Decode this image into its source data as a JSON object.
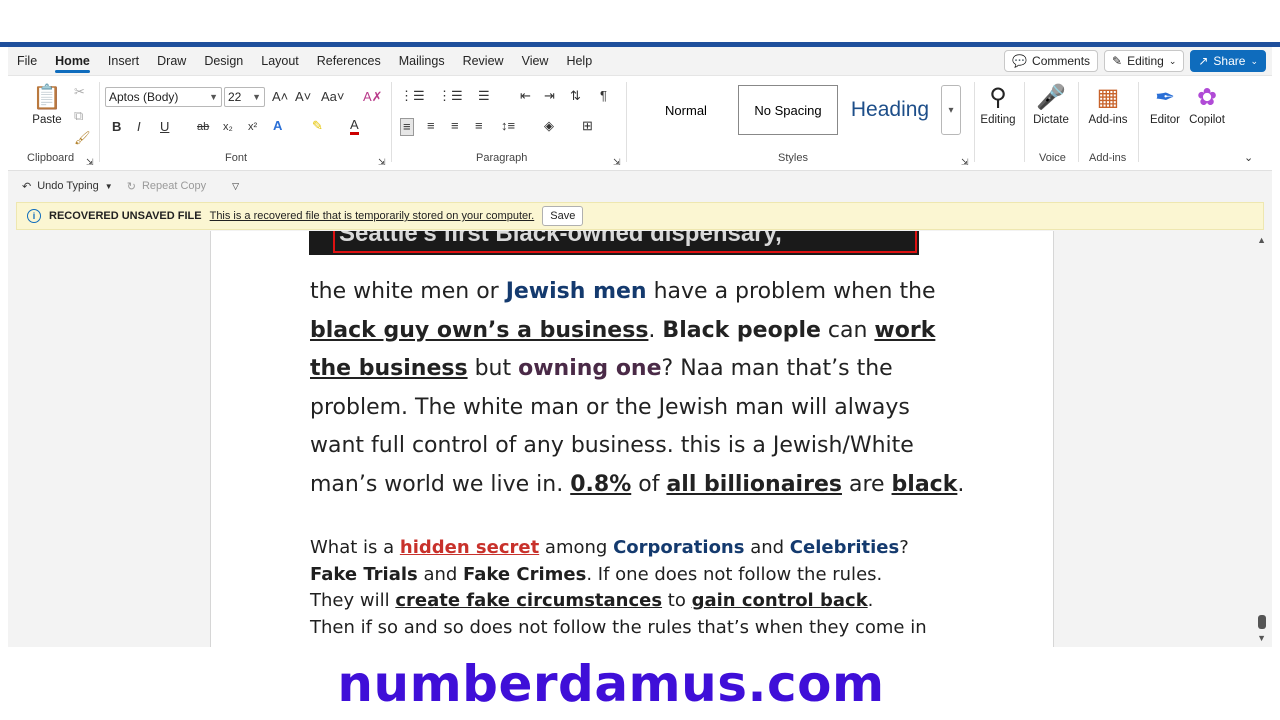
{
  "menu": {
    "items": [
      "File",
      "Home",
      "Insert",
      "Draw",
      "Design",
      "Layout",
      "References",
      "Mailings",
      "Review",
      "View",
      "Help"
    ],
    "active": "Home",
    "comments_label": "Comments",
    "editing_label": "Editing",
    "share_label": "Share"
  },
  "ribbon": {
    "paste_label": "Paste",
    "clipboard_label": "Clipboard",
    "font_name": "Aptos (Body)",
    "font_size": "22",
    "font_label": "Font",
    "paragraph_label": "Paragraph",
    "styles": [
      "Normal",
      "No Spacing",
      "Heading"
    ],
    "selected_style": "No Spacing",
    "styles_label": "Styles",
    "editing_btn": "Editing",
    "dictate_btn": "Dictate",
    "addins_btn": "Add-ins",
    "editor_btn": "Editor",
    "copilot_btn": "Copilot",
    "voice_label": "Voice",
    "addins_label": "Add-ins",
    "accent_color": "#0f6cbd"
  },
  "undo_row": {
    "undo_label": "Undo Typing",
    "repeat_label": "Repeat Copy"
  },
  "infobar": {
    "title": "RECOVERED UNSAVED FILE",
    "message": "This is a recovered file that is temporarily stored on your computer.",
    "save_label": "Save"
  },
  "document": {
    "image_caption": "Seattle's first Black-owned dispensary,",
    "p1": {
      "s1": "the white men or ",
      "s2": "Jewish men",
      "s3": " have a problem when the ",
      "s4": "black guy own’s a business",
      "s5": ". ",
      "s6": "Black people",
      "s7": " can ",
      "s8": "work the business",
      "s9": " but ",
      "s10": "owning one",
      "s11": "? Naa man that’s the problem. The white man or the Jewish man will always want full control of any business. this is a Jewish/White man’s world we live in. ",
      "s12": "0.8%",
      "s13": " of ",
      "s14": "all billionaires",
      "s15": " are ",
      "s16": "black",
      "s17": "."
    },
    "p2": {
      "l1a": "What is a ",
      "l1b": "hidden secret",
      "l1c": " among ",
      "l1d": "Corporations",
      "l1e": " and ",
      "l1f": "Celebrities",
      "l1g": "?",
      "l2a": "Fake Trials",
      "l2b": " and ",
      "l2c": "Fake Crimes",
      "l2d": ". If one does not follow the rules.",
      "l3a": "They will ",
      "l3b": "create fake circumstances",
      "l3c": " to ",
      "l3d": "gain control back",
      "l3e": ".",
      "l4": "Then if so and so does not follow the rules that’s when they come in"
    }
  },
  "watermark": "numberdamus.com"
}
